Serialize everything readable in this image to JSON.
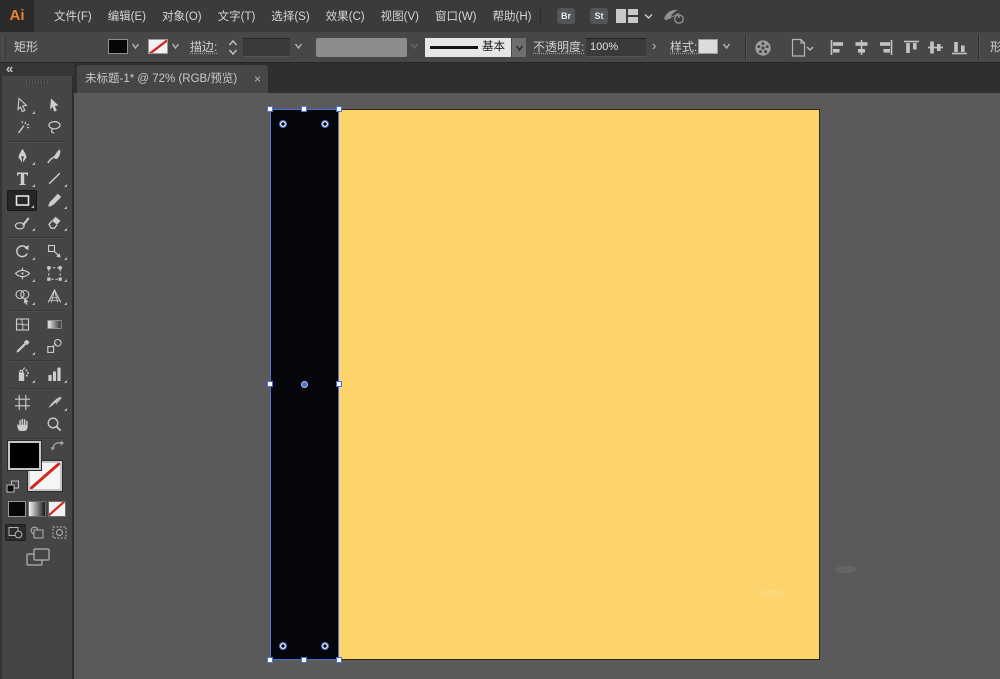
{
  "menu": {
    "logo": "Ai",
    "items": [
      {
        "name": "file",
        "label": "文件(F)"
      },
      {
        "name": "edit",
        "label": "编辑(E)"
      },
      {
        "name": "object",
        "label": "对象(O)"
      },
      {
        "name": "type",
        "label": "文字(T)"
      },
      {
        "name": "select",
        "label": "选择(S)"
      },
      {
        "name": "effect",
        "label": "效果(C)"
      },
      {
        "name": "view",
        "label": "视图(V)"
      },
      {
        "name": "window",
        "label": "窗口(W)"
      },
      {
        "name": "help",
        "label": "帮助(H)"
      }
    ],
    "bridge_button": "Br",
    "stock_button": "St"
  },
  "controlbar": {
    "tool_label": "矩形",
    "stroke_label": "描边:",
    "brush_style": "基本",
    "opacity_label": "不透明度:",
    "opacity_value": "100%",
    "opacity_more": "›",
    "style_label": "样式:",
    "clipped_label": "形",
    "align_icons": [
      "align-left",
      "align-center-horizontal",
      "align-right",
      "align-top",
      "align-center-vertical",
      "align-bottom"
    ]
  },
  "tab": {
    "title": "未标题-1* @ 72% (RGB/预览)",
    "close": "×"
  },
  "panel": {
    "collapse": "«"
  },
  "tools": [
    {
      "row": 0,
      "col": 0,
      "name": "direct-selection",
      "flyout": true
    },
    {
      "row": 0,
      "col": 1,
      "name": "selection"
    },
    {
      "row": 1,
      "col": 0,
      "name": "magic-wand"
    },
    {
      "row": 1,
      "col": 1,
      "name": "lasso"
    },
    {
      "row": 2,
      "col": 0,
      "name": "pen",
      "flyout": true
    },
    {
      "row": 2,
      "col": 1,
      "name": "curvature"
    },
    {
      "row": 3,
      "col": 0,
      "name": "type",
      "flyout": true
    },
    {
      "row": 3,
      "col": 1,
      "name": "line-segment",
      "flyout": true
    },
    {
      "row": 4,
      "col": 0,
      "name": "rectangle",
      "flyout": true,
      "selected": true
    },
    {
      "row": 4,
      "col": 1,
      "name": "paintbrush",
      "flyout": true
    },
    {
      "row": 5,
      "col": 0,
      "name": "shaper",
      "flyout": true
    },
    {
      "row": 5,
      "col": 1,
      "name": "eraser",
      "flyout": true
    },
    {
      "row": 6,
      "col": 0,
      "name": "rotate",
      "flyout": true
    },
    {
      "row": 6,
      "col": 1,
      "name": "scale",
      "flyout": true
    },
    {
      "row": 7,
      "col": 0,
      "name": "width",
      "flyout": true
    },
    {
      "row": 7,
      "col": 1,
      "name": "free-transform",
      "flyout": true
    },
    {
      "row": 8,
      "col": 0,
      "name": "shape-builder",
      "flyout": true
    },
    {
      "row": 8,
      "col": 1,
      "name": "perspective-grid",
      "flyout": true
    },
    {
      "row": 9,
      "col": 0,
      "name": "mesh"
    },
    {
      "row": 9,
      "col": 1,
      "name": "gradient"
    },
    {
      "row": 10,
      "col": 0,
      "name": "eyedropper",
      "flyout": true
    },
    {
      "row": 10,
      "col": 1,
      "name": "blend"
    },
    {
      "row": 11,
      "col": 0,
      "name": "symbol-sprayer",
      "flyout": true
    },
    {
      "row": 11,
      "col": 1,
      "name": "column-graph",
      "flyout": true
    },
    {
      "row": 12,
      "col": 0,
      "name": "artboard"
    },
    {
      "row": 12,
      "col": 1,
      "name": "slice",
      "flyout": true
    },
    {
      "row": 13,
      "col": 0,
      "name": "hand"
    },
    {
      "row": 13,
      "col": 1,
      "name": "zoom"
    }
  ],
  "colors": {
    "artboard_yellow": "#fcd46b",
    "selection_blue": "#4a72d8",
    "fill_black": "#010101",
    "logo_orange": "#e8833a",
    "none_red": "#cf2a20"
  }
}
